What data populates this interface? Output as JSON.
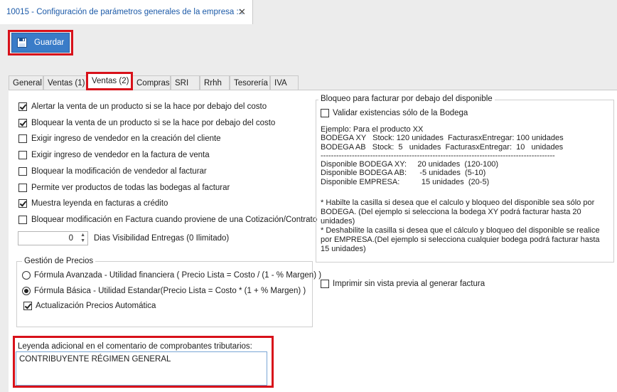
{
  "window": {
    "tab_title": "10015 - Configuración de parámetros generales de la empresa ::.",
    "close_glyph": "✕"
  },
  "toolbar": {
    "save_label": "Guardar"
  },
  "tabs": [
    {
      "label": "General",
      "active": false
    },
    {
      "label": "Ventas (1)",
      "active": false
    },
    {
      "label": "Ventas (2)",
      "active": true
    },
    {
      "label": "Compras",
      "active": false
    },
    {
      "label": "SRI",
      "active": false
    },
    {
      "label": "Rrhh",
      "active": false
    },
    {
      "label": "Tesorería",
      "active": false
    },
    {
      "label": "IVA",
      "active": false
    }
  ],
  "options": [
    {
      "label": "Alertar la venta de un producto si se la hace por debajo del costo",
      "checked": true
    },
    {
      "label": "Bloquear la venta de un producto si se la hace por debajo del costo",
      "checked": true
    },
    {
      "label": "Exigir ingreso de vendedor en la creación del cliente",
      "checked": false
    },
    {
      "label": "Exigir ingreso de vendedor en la factura de venta",
      "checked": false
    },
    {
      "label": "Bloquear la modificación de vendedor al facturar",
      "checked": false
    },
    {
      "label": "Permite ver productos de todas las bodegas al facturar",
      "checked": false
    },
    {
      "label": "Muestra leyenda en facturas a crédito",
      "checked": true
    },
    {
      "label": "Bloquear modificación en Factura cuando proviene de una Cotización/Contrato",
      "checked": false
    }
  ],
  "delivery": {
    "value": "0",
    "label": "Dias Visibilidad Entregas (0 Ilimitado)"
  },
  "pricing": {
    "title": "Gestión de Precios",
    "advanced": "Fórmula Avanzada - Utilidad financiera ( Precio Lista = Costo / (1 - % Margen) )",
    "basic": "Fórmula Básica - Utilidad Estandar(Precio Lista = Costo * (1 + % Margen) )",
    "selected": "basic",
    "auto_label": "Actualización Precios Automática",
    "auto_checked": true
  },
  "legend": {
    "label": "Leyenda adicional en el comentario de comprobantes tributarios:",
    "value": "CONTRIBUYENTE RÉGIMEN GENERAL"
  },
  "block_group": {
    "title": "Bloqueo para facturar por debajo del disponible",
    "validate_label": "Validar existencias sólo de la Bodega",
    "validate_checked": false,
    "example": "Ejemplo: Para el producto XX\nBODEGA XY   Stock: 120 unidades  FacturasxEntregar: 100 unidades\nBODEGA AB   Stock:  5   unidades  FacturasxEntregar:  10   unidades\n------------------------------------------------------------------------------------------\nDisponible BODEGA XY:     20 unidades  (120-100)\nDisponible BODEGA AB:      -5 unidades  (5-10)\nDisponible EMPRESA:          15 unidades  (20-5)",
    "note1": "* Habilte la casilla si desea que el calculo y bloqueo del disponible sea sólo por BODEGA. (Del ejemplo si selecciona la bodega XY podrá facturar hasta 20 unidades)",
    "note2": "* Deshabilite la casilla si desea que el cálculo y bloqueo del disponible se realice por EMPRESA.(Del ejemplo si selecciona cualquier bodega podrá facturar hasta 15 unidades)"
  },
  "print_preview": {
    "label": "Imprimir sin vista previa al generar factura",
    "checked": false
  }
}
